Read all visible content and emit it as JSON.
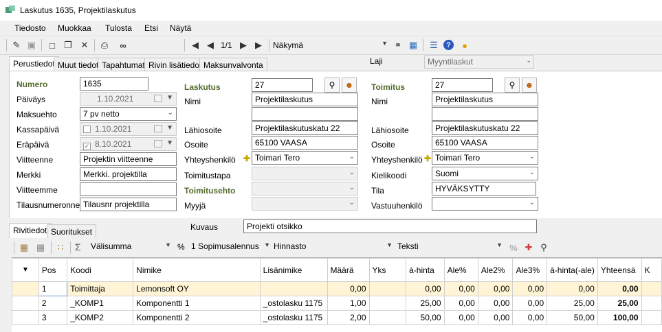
{
  "window": {
    "title": "Laskutus 1635, Projektilaskutus"
  },
  "menu": [
    "Tiedosto",
    "Muokkaa",
    "Tulosta",
    "Etsi",
    "Näytä"
  ],
  "toolbar": {
    "pager": "1/1",
    "view_label": "Näkymä",
    "view_value": ""
  },
  "tabs": [
    {
      "label": "Perustiedot",
      "active": true
    },
    {
      "label": "Muut tiedot"
    },
    {
      "label": "Tapahtumat"
    },
    {
      "label": "Rivin lisätiedot"
    },
    {
      "label": "Maksunvalvonta"
    }
  ],
  "laji": {
    "label": "Laji",
    "value": "Myyntilaskut"
  },
  "left": {
    "numero_label": "Numero",
    "numero": "1635",
    "paivays_label": "Päiväys",
    "paivays": "1.10.2021",
    "maksuehto_label": "Maksuehto",
    "maksuehto": "7 pv netto",
    "kassapaiva_label": "Kassapäivä",
    "kassapaiva": "1.10.2021",
    "erapaiva_label": "Eräpäivä",
    "erapaiva": "8.10.2021",
    "viitteenne_label": "Viitteenne",
    "viitteenne": "Projektin viitteenne",
    "merkki_label": "Merkki",
    "merkki": "Merkki. projektilla",
    "viitteemme_label": "Viitteemme",
    "viitteemme": "",
    "tilausnumeronne_label": "Tilausnumeronne",
    "tilausnumeronne": "Tilausnr projektilla"
  },
  "mid": {
    "laskutus_label": "Laskutus",
    "laskutus": "27",
    "nimi_label": "Nimi",
    "nimi": "Projektilaskutus",
    "nimi2": "",
    "lahiosoite_label": "Lähiosoite",
    "lahiosoite": "Projektilaskutuskatu 22",
    "osoite_label": "Osoite",
    "osoite": "65100  VAASA",
    "yhteyshenkilo_label": "Yhteyshenkilö",
    "yhteyshenkilo": "Toimari Tero",
    "toimitustapa_label": "Toimitustapa",
    "toimitustapa": "",
    "toimitusehto_label": "Toimitusehto",
    "toimitusehto": "",
    "myyja_label": "Myyjä",
    "myyja": ""
  },
  "right": {
    "toimitus_label": "Toimitus",
    "toimitus": "27",
    "nimi_label": "Nimi",
    "nimi": "Projektilaskutus",
    "nimi2": "",
    "lahiosoite_label": "Lähiosoite",
    "lahiosoite": "Projektilaskutuskatu 22",
    "osoite_label": "Osoite",
    "osoite": "65100  VAASA",
    "yhteyshenkilo_label": "Yhteyshenkilö",
    "yhteyshenkilo": "Toimari Tero",
    "kielikoodi_label": "Kielikoodi",
    "kielikoodi": "Suomi",
    "tila_label": "Tila",
    "tila": "HYVÄKSYTTY",
    "vastuuhenkilo_label": "Vastuuhenkilö",
    "vastuuhenkilo": ""
  },
  "lower_tabs": [
    {
      "label": "Rivitiedot",
      "active": true
    },
    {
      "label": "Suoritukset"
    }
  ],
  "kuvaus": {
    "label": "Kuvaus",
    "value": "Projekti otsikko"
  },
  "grid_toolbar": {
    "sigma": "Σ",
    "valisumma": "Välisumma",
    "percent": "%",
    "sopimusalennus": "1 Sopimusalennus",
    "hinnasto": "Hinnasto",
    "teksti": "Teksti"
  },
  "grid": {
    "columns": [
      "Pos",
      "Koodi",
      "Nimike",
      "Lisänimike",
      "Määrä",
      "Yks",
      "à-hinta",
      "Ale%",
      "Ale2%",
      "Ale3%",
      "à-hinta(-ale)",
      "Yhteensä",
      "K"
    ],
    "rows": [
      [
        "1",
        "Toimittaja",
        "Lemonsoft OY",
        "",
        "0,00",
        "",
        "0,00",
        "0,00",
        "0,00",
        "0,00",
        "0,00",
        "0,00",
        ""
      ],
      [
        "2",
        "_KOMP1",
        "Komponentti 1",
        "_ostolasku 1175",
        "1,00",
        "",
        "25,00",
        "0,00",
        "0,00",
        "0,00",
        "25,00",
        "25,00",
        ""
      ],
      [
        "3",
        "_KOMP2",
        "Komponentti 2",
        "_ostolasku 1175",
        "2,00",
        "",
        "50,00",
        "0,00",
        "0,00",
        "0,00",
        "50,00",
        "100,00",
        ""
      ]
    ]
  },
  "colors": {
    "section_label": "#556b2f",
    "selected_row": "#fff5d6"
  }
}
